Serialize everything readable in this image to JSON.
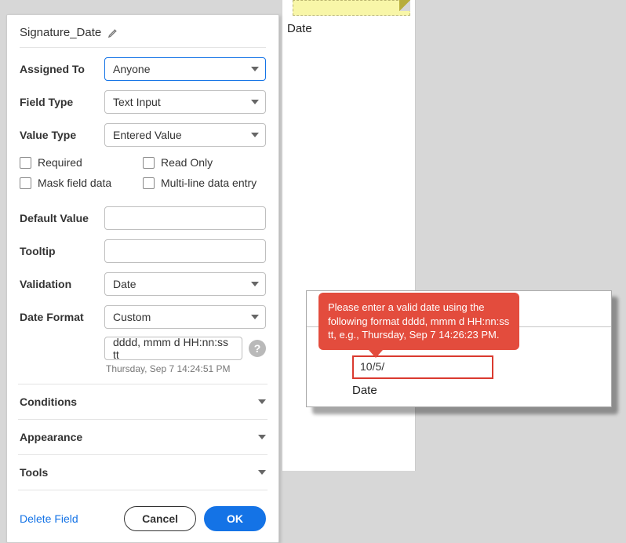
{
  "sticky_label": "Date",
  "panel": {
    "title": "Signature_Date",
    "assigned_to": {
      "label": "Assigned To",
      "value": "Anyone"
    },
    "field_type": {
      "label": "Field Type",
      "value": "Text Input"
    },
    "value_type": {
      "label": "Value Type",
      "value": "Entered Value"
    },
    "checks": {
      "required": "Required",
      "read_only": "Read Only",
      "mask": "Mask field data",
      "multiline": "Multi-line data entry"
    },
    "default_value": {
      "label": "Default Value",
      "value": ""
    },
    "tooltip_row": {
      "label": "Tooltip",
      "value": ""
    },
    "validation": {
      "label": "Validation",
      "value": "Date"
    },
    "date_format": {
      "label": "Date Format",
      "value": "Custom"
    },
    "format_string": "dddd, mmm d  HH:nn:ss tt",
    "format_preview": "Thursday, Sep 7 14:24:51 PM",
    "sections": {
      "conditions": "Conditions",
      "appearance": "Appearance",
      "tools": "Tools"
    },
    "footer": {
      "delete": "Delete Field",
      "cancel": "Cancel",
      "ok": "OK"
    }
  },
  "popup": {
    "tooltip_text": "Please enter a valid date using the following format dddd, mmm d HH:nn:ss tt, e.g., Thursday, Sep 7 14:26:23 PM.",
    "input_value": "10/5/",
    "caption": "Date"
  }
}
